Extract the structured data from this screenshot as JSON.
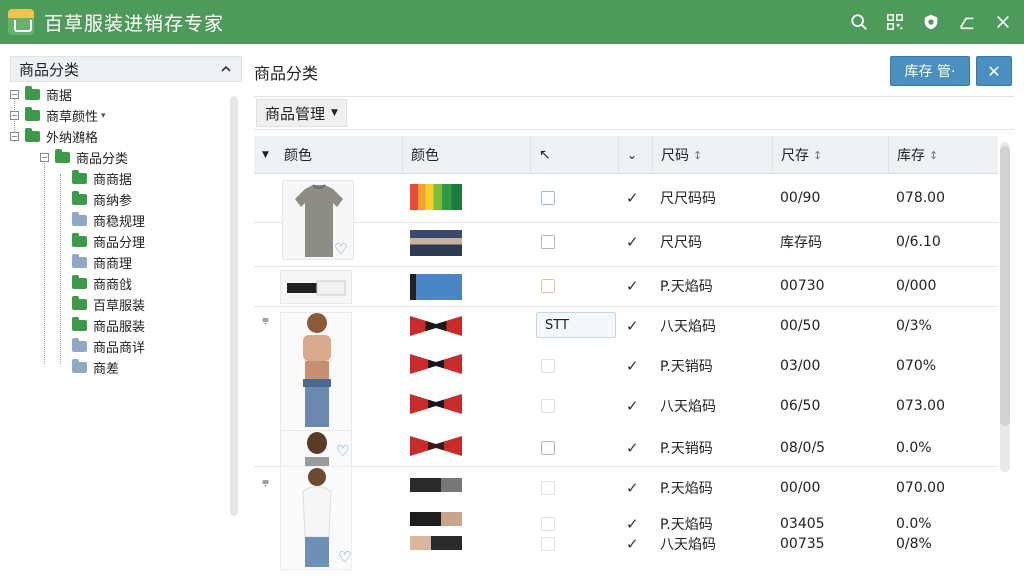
{
  "app": {
    "title": "百草服装进销存专家",
    "accent": "#4e9a5a",
    "button_color": "#4a8fbf"
  },
  "titlebar_icons": [
    "search-icon",
    "qr-icon",
    "shield-icon",
    "minimize-icon",
    "close-icon"
  ],
  "sidebar": {
    "header": "商品分类",
    "items": [
      {
        "label": "商据",
        "toggle": "-",
        "folder": "green"
      },
      {
        "label": "商草颜性",
        "toggle": "-",
        "folder": "green",
        "suffix": "▾"
      },
      {
        "label": "外纳鶐格",
        "toggle": "-",
        "folder": "green"
      },
      {
        "label": "商品分类",
        "toggle": "-",
        "folder": "green"
      },
      {
        "label": "商商据",
        "folder": "green"
      },
      {
        "label": "商纳参",
        "folder": "green"
      },
      {
        "label": "商稳规理",
        "folder": "grey"
      },
      {
        "label": "商品分理",
        "folder": "green"
      },
      {
        "label": "商商理",
        "folder": "grey"
      },
      {
        "label": "商商戗",
        "folder": "green"
      },
      {
        "label": "百草服装",
        "folder": "green"
      },
      {
        "label": "商品服装",
        "folder": "green"
      },
      {
        "label": "商品商详",
        "folder": "grey"
      },
      {
        "label": "商差",
        "folder": "grey"
      }
    ]
  },
  "main": {
    "title": "商品分类",
    "stock_button": "库存 管·",
    "close_button": "✕",
    "dropdown": "商品管理",
    "columns": {
      "photo": "颜色",
      "color": "颜色",
      "check_icon": "↖",
      "code": "尺码",
      "size": "尺存",
      "stock": "库存"
    },
    "input_value": "STT",
    "rows": [
      {
        "code": "尺尺码码",
        "size": "00/90",
        "stock": "078.00"
      },
      {
        "code": "尺尺码",
        "size": "库存码",
        "stock": "0/6.10"
      },
      {
        "code": "P.天焰码",
        "size": "00730",
        "stock": "0/000"
      },
      {
        "code": "八天焰码",
        "size": "00/50",
        "stock": "0/3%"
      },
      {
        "code": "P.天销码",
        "size": "03/00",
        "stock": "070%"
      },
      {
        "code": "八天焰码",
        "size": "06/50",
        "stock": "073.00"
      },
      {
        "code": "P.天销码",
        "size": "08/0/5",
        "stock": "0.0%"
      },
      {
        "code": "P.天焰码",
        "size": "00/00",
        "stock": "070.00"
      },
      {
        "code": "P.天焰码",
        "size": "03405",
        "stock": "0.0%"
      },
      {
        "code": "八天焰码",
        "size": "00735",
        "stock": "0/8%"
      }
    ]
  }
}
